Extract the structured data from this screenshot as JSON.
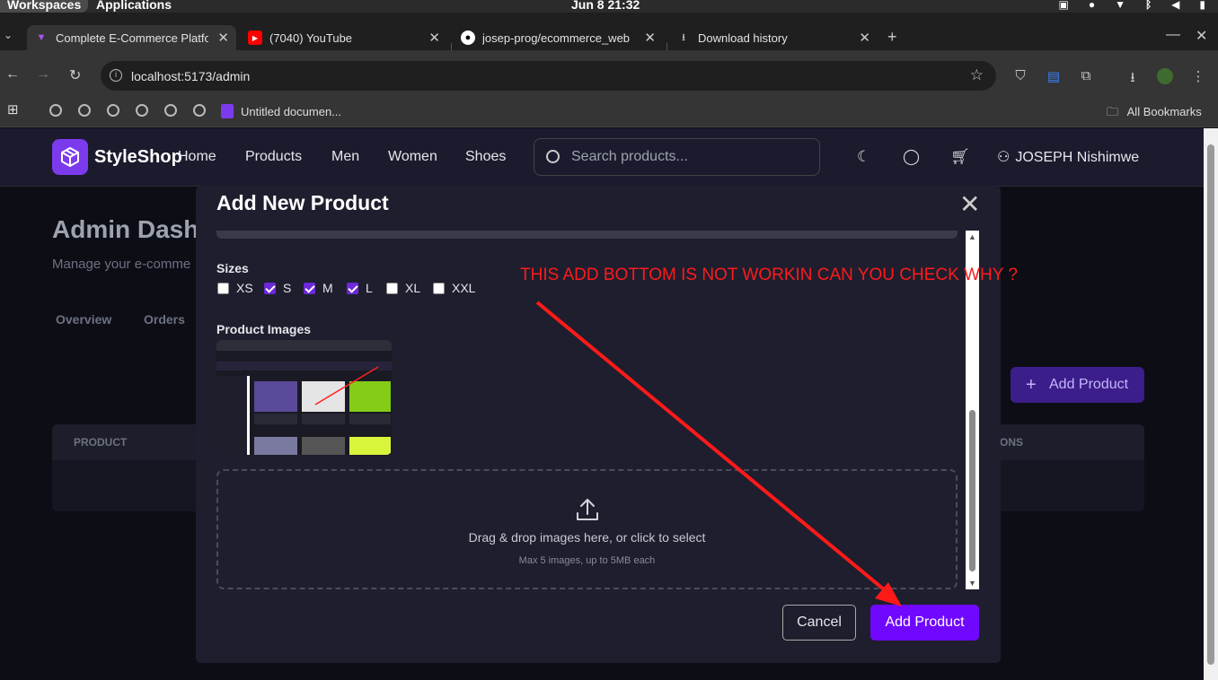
{
  "os": {
    "workspaces": "Workspaces",
    "applications": "Applications",
    "clock": "Jun 8  21:32"
  },
  "tabs": [
    {
      "title": "Complete E-Commerce Platfo",
      "active": true
    },
    {
      "title": "(7040) YouTube"
    },
    {
      "title": "josep-prog/ecommerce_web"
    },
    {
      "title": "Download history"
    }
  ],
  "address": {
    "url": "localhost:5173/admin"
  },
  "bookmarks": {
    "doc": "Untitled documen...",
    "all": "All Bookmarks"
  },
  "site": {
    "brand": "StyleShop",
    "nav": [
      "Home",
      "Products",
      "Men",
      "Women",
      "Shoes"
    ],
    "search_placeholder": "Search products...",
    "user": "JOSEPH Nishimwe"
  },
  "page": {
    "title": "Admin Dash",
    "subtitle": "Manage your e-comme",
    "tabs": [
      "Overview",
      "Orders"
    ],
    "add_product": "Add Product",
    "table_headers": [
      "PRODUCT",
      "ONS"
    ]
  },
  "modal": {
    "title": "Add New Product",
    "sizes_label": "Sizes",
    "sizes": [
      {
        "label": "XS",
        "checked": false
      },
      {
        "label": "S",
        "checked": true
      },
      {
        "label": "M",
        "checked": true
      },
      {
        "label": "L",
        "checked": true
      },
      {
        "label": "XL",
        "checked": false
      },
      {
        "label": "XXL",
        "checked": false
      }
    ],
    "images_label": "Product Images",
    "dropzone_main": "Drag & drop images here, or click to select",
    "dropzone_sub": "Max 5 images, up to 5MB each",
    "cancel": "Cancel",
    "submit": "Add Product"
  },
  "annotation": "THIS ADD BOTTOM IS NOT WORKIN CAN YOU CHECK WHY ?",
  "colors": {
    "accent": "#7008ff",
    "annotation": "#ff1a1a",
    "header": "#1c1b2e"
  }
}
